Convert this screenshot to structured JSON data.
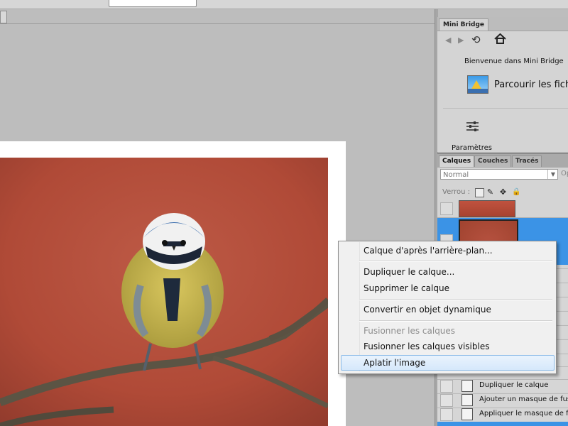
{
  "mini_bridge": {
    "tab": "Mini Bridge",
    "welcome": "Bienvenue dans Mini Bridge",
    "browse": "Parcourir les fichie",
    "settings": "Paramètres"
  },
  "layers_panel": {
    "tabs": [
      "Calques",
      "Couches",
      "Tracés"
    ],
    "blend_mode": "Normal",
    "opacity_label": "Op",
    "lock_label": "Verrou :"
  },
  "history": {
    "items": [
      "Dupliquer le calque",
      "Ajouter un masque de fusio",
      "Appliquer le masque de fusi"
    ]
  },
  "context_menu": {
    "items": [
      {
        "label": "Calque d'après l'arrière-plan...",
        "disabled": false
      },
      {
        "label": "Dupliquer le calque...",
        "disabled": false
      },
      {
        "label": "Supprimer le calque",
        "disabled": false
      },
      {
        "label": "Convertir en objet dynamique",
        "disabled": false
      },
      {
        "label": "Fusionner les calques",
        "disabled": true
      },
      {
        "label": "Fusionner les calques visibles",
        "disabled": false
      },
      {
        "label": "Aplatir l'image",
        "disabled": false,
        "highlighted": true
      }
    ]
  },
  "colors": {
    "selection": "#3b93e6",
    "photo_background": "#b5513f"
  },
  "icons": {
    "nav_back": "triangle-left-icon",
    "nav_forward": "triangle-right-icon",
    "sync": "sync-icon",
    "home": "home-icon",
    "settings": "sliders-icon"
  }
}
